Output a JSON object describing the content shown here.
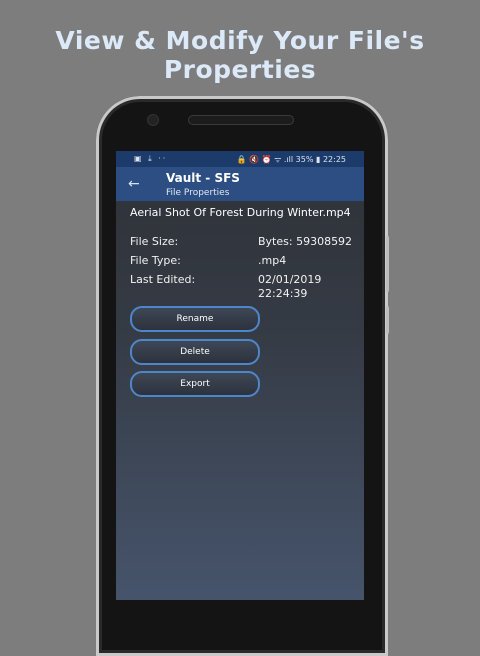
{
  "promo": {
    "headline_line1": "View & Modify Your File's",
    "headline_line2": "Properties"
  },
  "status_bar": {
    "left_icons": "▣ ⤓ ··",
    "right": "🔒 🔇 ⏰ ᯤ .ıll 35% ▮ 22:25"
  },
  "app_bar": {
    "back_icon": "←",
    "title": "Vault - SFS",
    "subtitle": "File Properties"
  },
  "file": {
    "name": "Aerial Shot Of Forest During Winter.mp4",
    "size_label": "File Size:",
    "size_value": "Bytes: 59308592",
    "type_label": "File Type:",
    "type_value": ".mp4",
    "edited_label": "Last Edited:",
    "edited_date": "02/01/2019",
    "edited_time": "22:24:39"
  },
  "actions": {
    "rename": "Rename",
    "delete": "Delete",
    "export": "Export"
  },
  "colors": {
    "background": "#7d7d7d",
    "status_bar": "#1c3b6a",
    "app_bar": "#2d4e82",
    "button_border": "#4f86c9",
    "headline": "#dce9f8"
  }
}
